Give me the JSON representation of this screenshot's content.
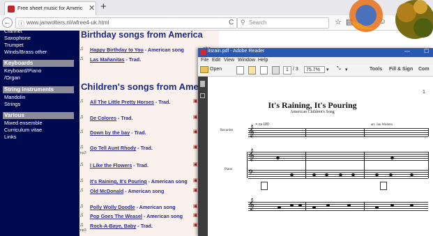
{
  "browser": {
    "tab_title": "Free sheet music for Americ",
    "tab_close": "✕",
    "new_tab": "+",
    "back": "←",
    "info": "ⓘ",
    "url": "www.janwolters.nl/wfree4-uk.html",
    "reload": "C",
    "search_icon": "⚲",
    "search_placeholder": "Search",
    "toolbar_icons": [
      "☆",
      "▤",
      "⬇",
      "⌂",
      "☺",
      "⋯",
      "≡"
    ]
  },
  "sidebar": {
    "top_items": [
      "Clarinet",
      "Saxophone",
      "Trumpet",
      "Winds/Brass other"
    ],
    "keyboards_head": "Keyboards",
    "keyboards_items": [
      "Keyboard/Piano",
      "/Organ"
    ],
    "strings_head": "String instruments",
    "strings_items": [
      "Mandolin",
      "Strings"
    ],
    "various_head": "Various",
    "various_items": [
      "Mixed ensemble",
      "Curriculum vitae",
      "Links"
    ]
  },
  "content": {
    "birthday_heading": "Birthday songs from America",
    "birthday_songs": [
      {
        "title": "Happy Birthday to You",
        "suffix": " - American song",
        "sheet": "she"
      },
      {
        "title": "Las Mañanitas",
        "suffix": " - Trad.",
        "sheet": "she"
      }
    ],
    "children_heading": "Children's songs from America",
    "children_songs": [
      {
        "title": "All The Little Pretty Horses",
        "suffix": " - Trad.",
        "sheet": "she"
      },
      {
        "title": "De Colores",
        "suffix": " - Trad.",
        "sheet": "she"
      },
      {
        "title": "Down by the bay",
        "suffix": " - Trad.",
        "sheet": "she"
      },
      {
        "title": "Go Tell Aunt Rhody",
        "suffix": " - Trad.",
        "sheet": "she"
      },
      {
        "title": "I Like the Flowers",
        "suffix": " - Trad.",
        "sheet": "she"
      },
      {
        "title": "It's Raining, It's Pouring",
        "suffix": " - American song",
        "sheet": "she"
      },
      {
        "title": "Old McDonald",
        "suffix": " - American song",
        "sheet": "she"
      },
      {
        "title": "Polly Wolly Doodle",
        "suffix": " - American song",
        "sheet": "she"
      },
      {
        "title": "Pop Goes The Weasel",
        "suffix": " - American song",
        "sheet": "she"
      },
      {
        "title": "Rock-A-Baye, Baby",
        "suffix": " - Trad.",
        "sheet": "she"
      }
    ],
    "mp3_label": "mp3"
  },
  "pdf": {
    "window_title": "itsrain.pdf - Adobe Reader",
    "menu": [
      "File",
      "Edit",
      "View",
      "Window",
      "Help"
    ],
    "open_label": "Open",
    "page_current": "1",
    "page_total": "/ 3",
    "zoom": "75.7%",
    "tools_label": "Tools",
    "fillsign_label": "Fill & Sign",
    "comment_label": "Com",
    "page_number": "1",
    "score_title": "It's Raining, It's Pouring",
    "score_subtitle": "American Children's Song",
    "arranger": "arr. Jan Wolters",
    "tempo": "♩ = ca 180",
    "part_recorder": "Recorder",
    "part_piano": "Piano",
    "min_btn": "—",
    "max_btn": "☐"
  },
  "colors": {
    "sidebar_bg": "#000a4f",
    "content_bg": "#fbf1ec",
    "heading": "#1a2a7c",
    "acrobat_title": "#2a57b0"
  }
}
